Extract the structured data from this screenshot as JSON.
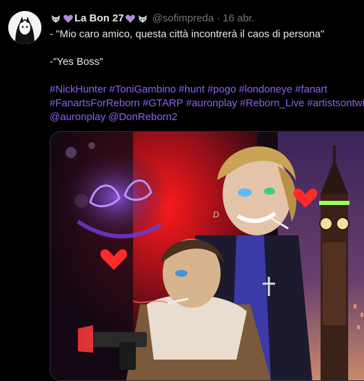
{
  "tweet": {
    "display_name": "La Bon 27",
    "handle": "@sofimpreda",
    "separator": "·",
    "time": "16 abr.",
    "text_line1": "- \"Mio caro amico, questa città incontrerà il caos di persona\"",
    "text_line2": "-\"Yes Boss\"",
    "hashtags_line1": [
      "#NickHunter",
      "#ToniGambino",
      "#hunt",
      "#pogo",
      "#londoneye",
      "#fanart"
    ],
    "hashtags_line2": [
      "#FanartsForReborn",
      "#GTARP",
      "#auronplay",
      "#Reborn_Live",
      "#artistsontwi"
    ],
    "mentions": [
      "@auronplay",
      "@DonReborn2"
    ],
    "colors": {
      "link": "#8c62f5",
      "secondary": "#71767b",
      "text": "#e7e9ea",
      "bg": "#000000"
    },
    "emoji_icons": [
      "fox-emoji",
      "purple-heart-emoji",
      "purple-heart-emoji",
      "fox-emoji"
    ]
  }
}
